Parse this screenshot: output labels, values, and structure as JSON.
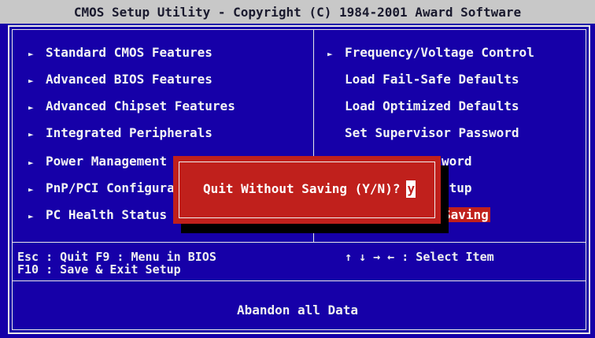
{
  "title": "CMOS Setup Utility - Copyright (C) 1984-2001 Award Software",
  "left_menu": [
    {
      "label": "Standard CMOS Features",
      "arrow": "►"
    },
    {
      "label": "Advanced BIOS Features",
      "arrow": "►"
    },
    {
      "label": "Advanced Chipset Features",
      "arrow": "►"
    },
    {
      "label": "Integrated Peripherals",
      "arrow": "►"
    },
    {
      "label": "Power Management",
      "arrow": "►"
    },
    {
      "label": "PnP/PCI Configura",
      "arrow": "►"
    },
    {
      "label": "PC Health Status",
      "arrow": "►"
    }
  ],
  "right_menu": [
    {
      "label": "Frequency/Voltage Control",
      "arrow": "►"
    },
    {
      "label": "Load Fail-Safe Defaults"
    },
    {
      "label": "Load Optimized Defaults"
    },
    {
      "label": "Set Supervisor Password"
    },
    {
      "label": "word"
    },
    {
      "label": "etup"
    },
    {
      "label": "Saving"
    }
  ],
  "help": {
    "line1_left": "Esc : Quit      F9 : Menu in BIOS",
    "line1_right": "↑ ↓ → ←   : Select Item",
    "line2": "F10 : Save & Exit Setup"
  },
  "status_text": "Abandon all Data",
  "dialog": {
    "prompt": "Quit Without Saving (Y/N)?",
    "input_value": "y"
  },
  "colors": {
    "background": "#1600a8",
    "title_bar": "#c8c8c8",
    "highlight": "#c0201c",
    "text": "#f0f0f0"
  }
}
